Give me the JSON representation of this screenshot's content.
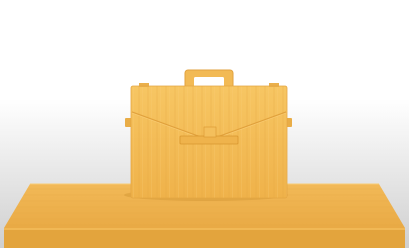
{
  "scene": {
    "subject": "briefcase-icon",
    "surface": "wooden-table",
    "colors": {
      "background_top": "#ffffff",
      "background_bottom": "#cfcfcf",
      "wood_light": "#f6c35f",
      "wood_mid": "#efb24a",
      "wood_dark": "#d9962f",
      "table_edge": "#e3a43d"
    }
  }
}
